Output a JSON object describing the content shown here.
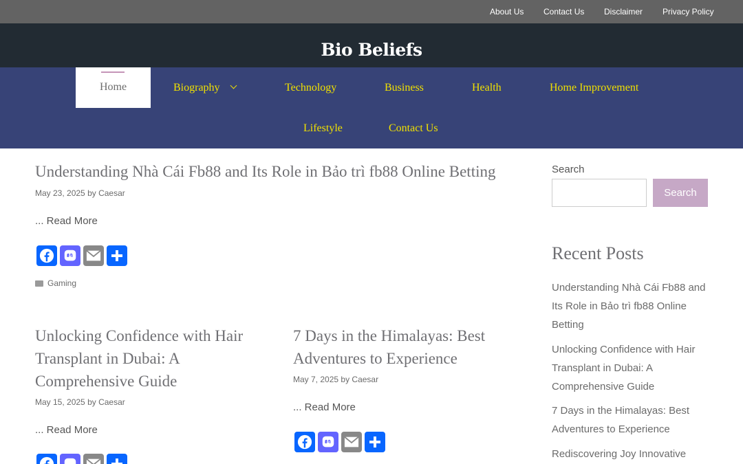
{
  "topnav": {
    "items": [
      "About Us",
      "Contact Us",
      "Disclaimer",
      "Privacy Policy"
    ]
  },
  "site": {
    "title": "Bio Beliefs"
  },
  "nav": {
    "items": [
      "Home",
      "Biography",
      "Technology",
      "Business",
      "Health",
      "Home Improvement",
      "Lifestyle",
      "Contact Us"
    ],
    "active": "Home"
  },
  "posts": [
    {
      "title": "Understanding Nhà Cái Fb88 and Its Role in Bảo trì fb88 Online Betting",
      "date": "May 23, 2025",
      "by": "by",
      "author": "Caesar",
      "read_more": "... Read More",
      "category": "Gaming"
    },
    {
      "title_lines": [
        "Unlocking Confidence with Hair",
        "Transplant in Dubai: A",
        "Comprehensive Guide"
      ],
      "date": "May 15, 2025",
      "by": "by",
      "author": "Caesar",
      "read_more": "... Read More"
    },
    {
      "title_lines": [
        "7 Days in the Himalayas: Best",
        "Adventures to Experience"
      ],
      "date": "May 7, 2025",
      "by": "by",
      "author": "Caesar",
      "read_more": "... Read More"
    }
  ],
  "share_icons": [
    "facebook-icon",
    "mastodon-icon",
    "email-icon",
    "share-icon"
  ],
  "sidebar": {
    "search_label": "Search",
    "search_value": "",
    "search_button": "Search",
    "recent_title": "Recent Posts",
    "recent": [
      [
        "Understanding Nhà Cái Fb88 and",
        "Its Role in Bảo trì fb88 Online",
        "Betting"
      ],
      [
        "Unlocking Confidence with Hair",
        "Transplant in Dubai: A",
        "Comprehensive Guide"
      ],
      [
        "7 Days in the Himalayas: Best",
        "Adventures to Experience"
      ],
      [
        "Rediscovering Joy Innovative"
      ]
    ]
  },
  "colors": {
    "topbar": "#636363",
    "header": "#222b33",
    "nav": "#374377",
    "nav_link": "#f0e000",
    "search_button": "#c6a8c6"
  }
}
